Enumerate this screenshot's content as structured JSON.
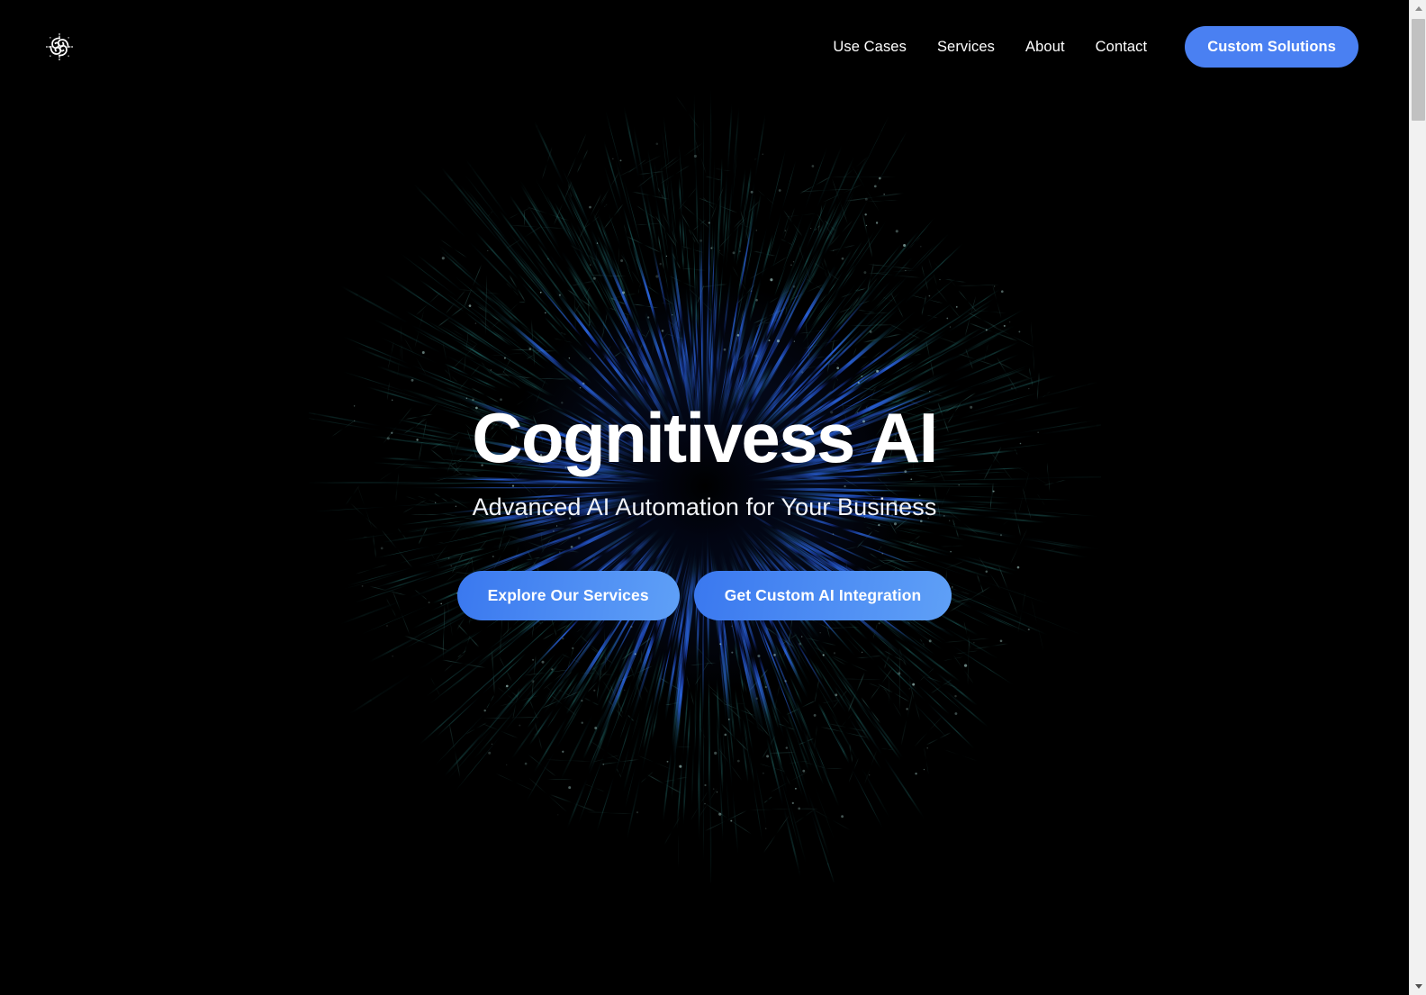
{
  "site": {
    "background_color": "#000000",
    "accent_color": "#4a80f2",
    "accent_gradient_from": "#3a78ef",
    "accent_gradient_to": "#5fa0f7"
  },
  "header": {
    "logo": {
      "icon": "celtic-knot-logo-icon",
      "color": "#ffffff"
    },
    "nav": [
      {
        "label": "Use Cases"
      },
      {
        "label": "Services"
      },
      {
        "label": "About"
      },
      {
        "label": "Contact"
      }
    ],
    "cta": {
      "label": "Custom Solutions"
    }
  },
  "hero": {
    "title": "Cognitivess AI",
    "subtitle": "Advanced AI Automation for Your Business",
    "buttons": [
      {
        "label": "Explore Our Services"
      },
      {
        "label": "Get Custom AI Integration"
      }
    ],
    "background": {
      "visual": "radial-burst-network-sphere",
      "inner_color": "#1d4ed8",
      "outer_color": "#1f6f6a"
    }
  },
  "scrollbar": {
    "up_arrow": "scroll-up-arrow-icon",
    "down_arrow": "scroll-down-arrow-icon",
    "thumb": "scrollbar-thumb"
  }
}
